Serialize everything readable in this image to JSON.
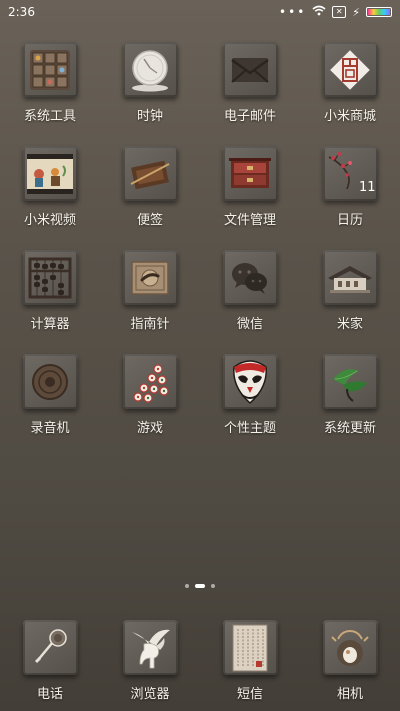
{
  "status_bar": {
    "time": "2:36",
    "more": "•••",
    "sim": "✕",
    "charging": "⚡"
  },
  "apps": [
    {
      "label": "系统工具",
      "icon": "toolbox-icon"
    },
    {
      "label": "时钟",
      "icon": "clock-icon"
    },
    {
      "label": "电子邮件",
      "icon": "envelope-icon"
    },
    {
      "label": "小米商城",
      "icon": "seal-icon"
    },
    {
      "label": "小米视频",
      "icon": "video-painting-icon"
    },
    {
      "label": "便签",
      "icon": "notes-icon"
    },
    {
      "label": "文件管理",
      "icon": "cabinet-icon"
    },
    {
      "label": "日历",
      "icon": "plum-calendar-icon",
      "badge": "11"
    },
    {
      "label": "计算器",
      "icon": "abacus-icon"
    },
    {
      "label": "指南针",
      "icon": "compass-icon"
    },
    {
      "label": "微信",
      "icon": "chat-icon"
    },
    {
      "label": "米家",
      "icon": "house-icon"
    },
    {
      "label": "录音机",
      "icon": "record-icon"
    },
    {
      "label": "游戏",
      "icon": "chess-icon"
    },
    {
      "label": "个性主题",
      "icon": "opera-mask-icon"
    },
    {
      "label": "系统更新",
      "icon": "leaf-icon"
    }
  ],
  "dock": [
    {
      "label": "电话",
      "icon": "phone-icon"
    },
    {
      "label": "浏览器",
      "icon": "pegasus-icon"
    },
    {
      "label": "短信",
      "icon": "calligraphy-icon"
    },
    {
      "label": "相机",
      "icon": "camera-pot-icon"
    }
  ],
  "pages": {
    "count": 3,
    "active": 1
  }
}
